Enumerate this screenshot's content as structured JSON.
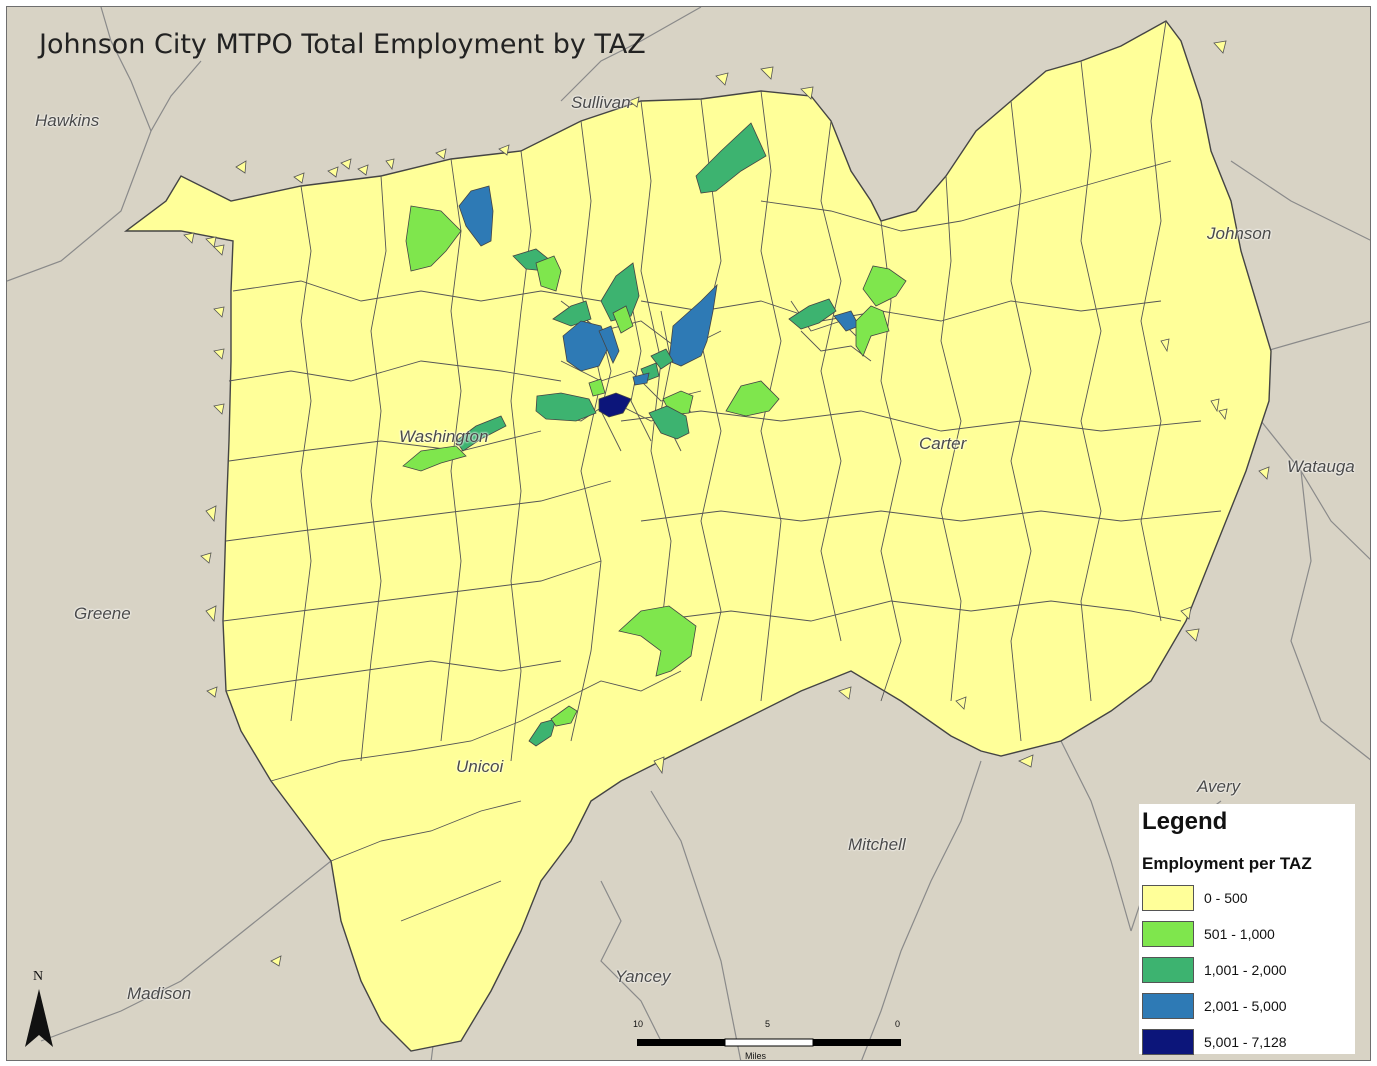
{
  "title": "Johnson City MTPO Total Employment by TAZ",
  "colors": {
    "background": "#d8d3c5",
    "class_0_500": "#ffff99",
    "class_501_1000": "#7fe64d",
    "class_1001_2000": "#3db370",
    "class_2001_5000": "#2e7ab5",
    "class_5001_7128": "#0c157a",
    "boundary": "#555555",
    "county_line": "#8a8a8a"
  },
  "county_labels": [
    "Hawkins",
    "Sullivan",
    "Johnson",
    "Washington",
    "Carter",
    "Watauga",
    "Greene",
    "Unicoi",
    "Avery",
    "Mitchell",
    "Yancey",
    "Madison"
  ],
  "legend": {
    "title": "Legend",
    "subtitle": "Employment per TAZ",
    "items": [
      {
        "label": "0 - 500",
        "color": "#ffff99"
      },
      {
        "label": "501 - 1,000",
        "color": "#7fe64d"
      },
      {
        "label": "1,001 - 2,000",
        "color": "#3db370"
      },
      {
        "label": "2,001 - 5,000",
        "color": "#2e7ab5"
      },
      {
        "label": "5,001 - 7,128",
        "color": "#0c157a"
      }
    ]
  },
  "north_arrow": {
    "label": "N"
  },
  "scale_bar": {
    "ticks": [
      "10",
      "5",
      "0"
    ],
    "unit": "Miles"
  }
}
